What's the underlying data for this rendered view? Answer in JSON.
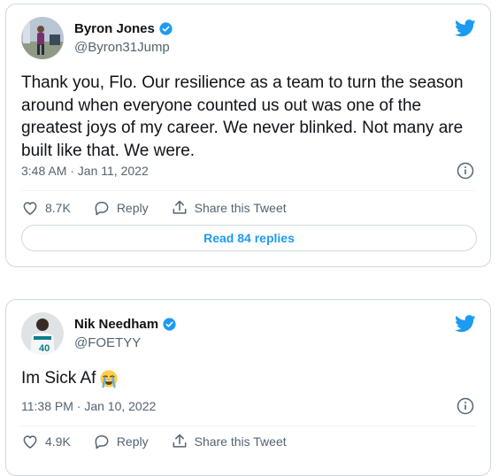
{
  "tweets": [
    {
      "display_name": "Byron Jones",
      "handle": "@Byron31Jump",
      "text": "Thank you, Flo. Our resilience as a team to turn the season around when everyone counted us out was one of the greatest joys of my career. We never blinked. Not many are built like that. We were.",
      "timestamp": "3:48 AM · Jan 11, 2022",
      "likes": "8.7K",
      "reply_label": "Reply",
      "share_label": "Share this Tweet",
      "read_replies_label": "Read 84 replies"
    },
    {
      "display_name": "Nik Needham",
      "handle": "@FOETYY",
      "text": "Im Sick Af",
      "emoji": "loudly-crying-face",
      "timestamp": "11:38 PM · Jan 10, 2022",
      "likes": "4.9K",
      "reply_label": "Reply",
      "share_label": "Share this Tweet"
    }
  ],
  "colors": {
    "accent": "#1d9bf0",
    "text": "#0f1419",
    "muted": "#536471",
    "border": "#cfd9de"
  },
  "icons": [
    "twitter-bird-icon",
    "verified-badge-icon",
    "info-icon",
    "heart-icon",
    "reply-icon",
    "share-icon"
  ]
}
